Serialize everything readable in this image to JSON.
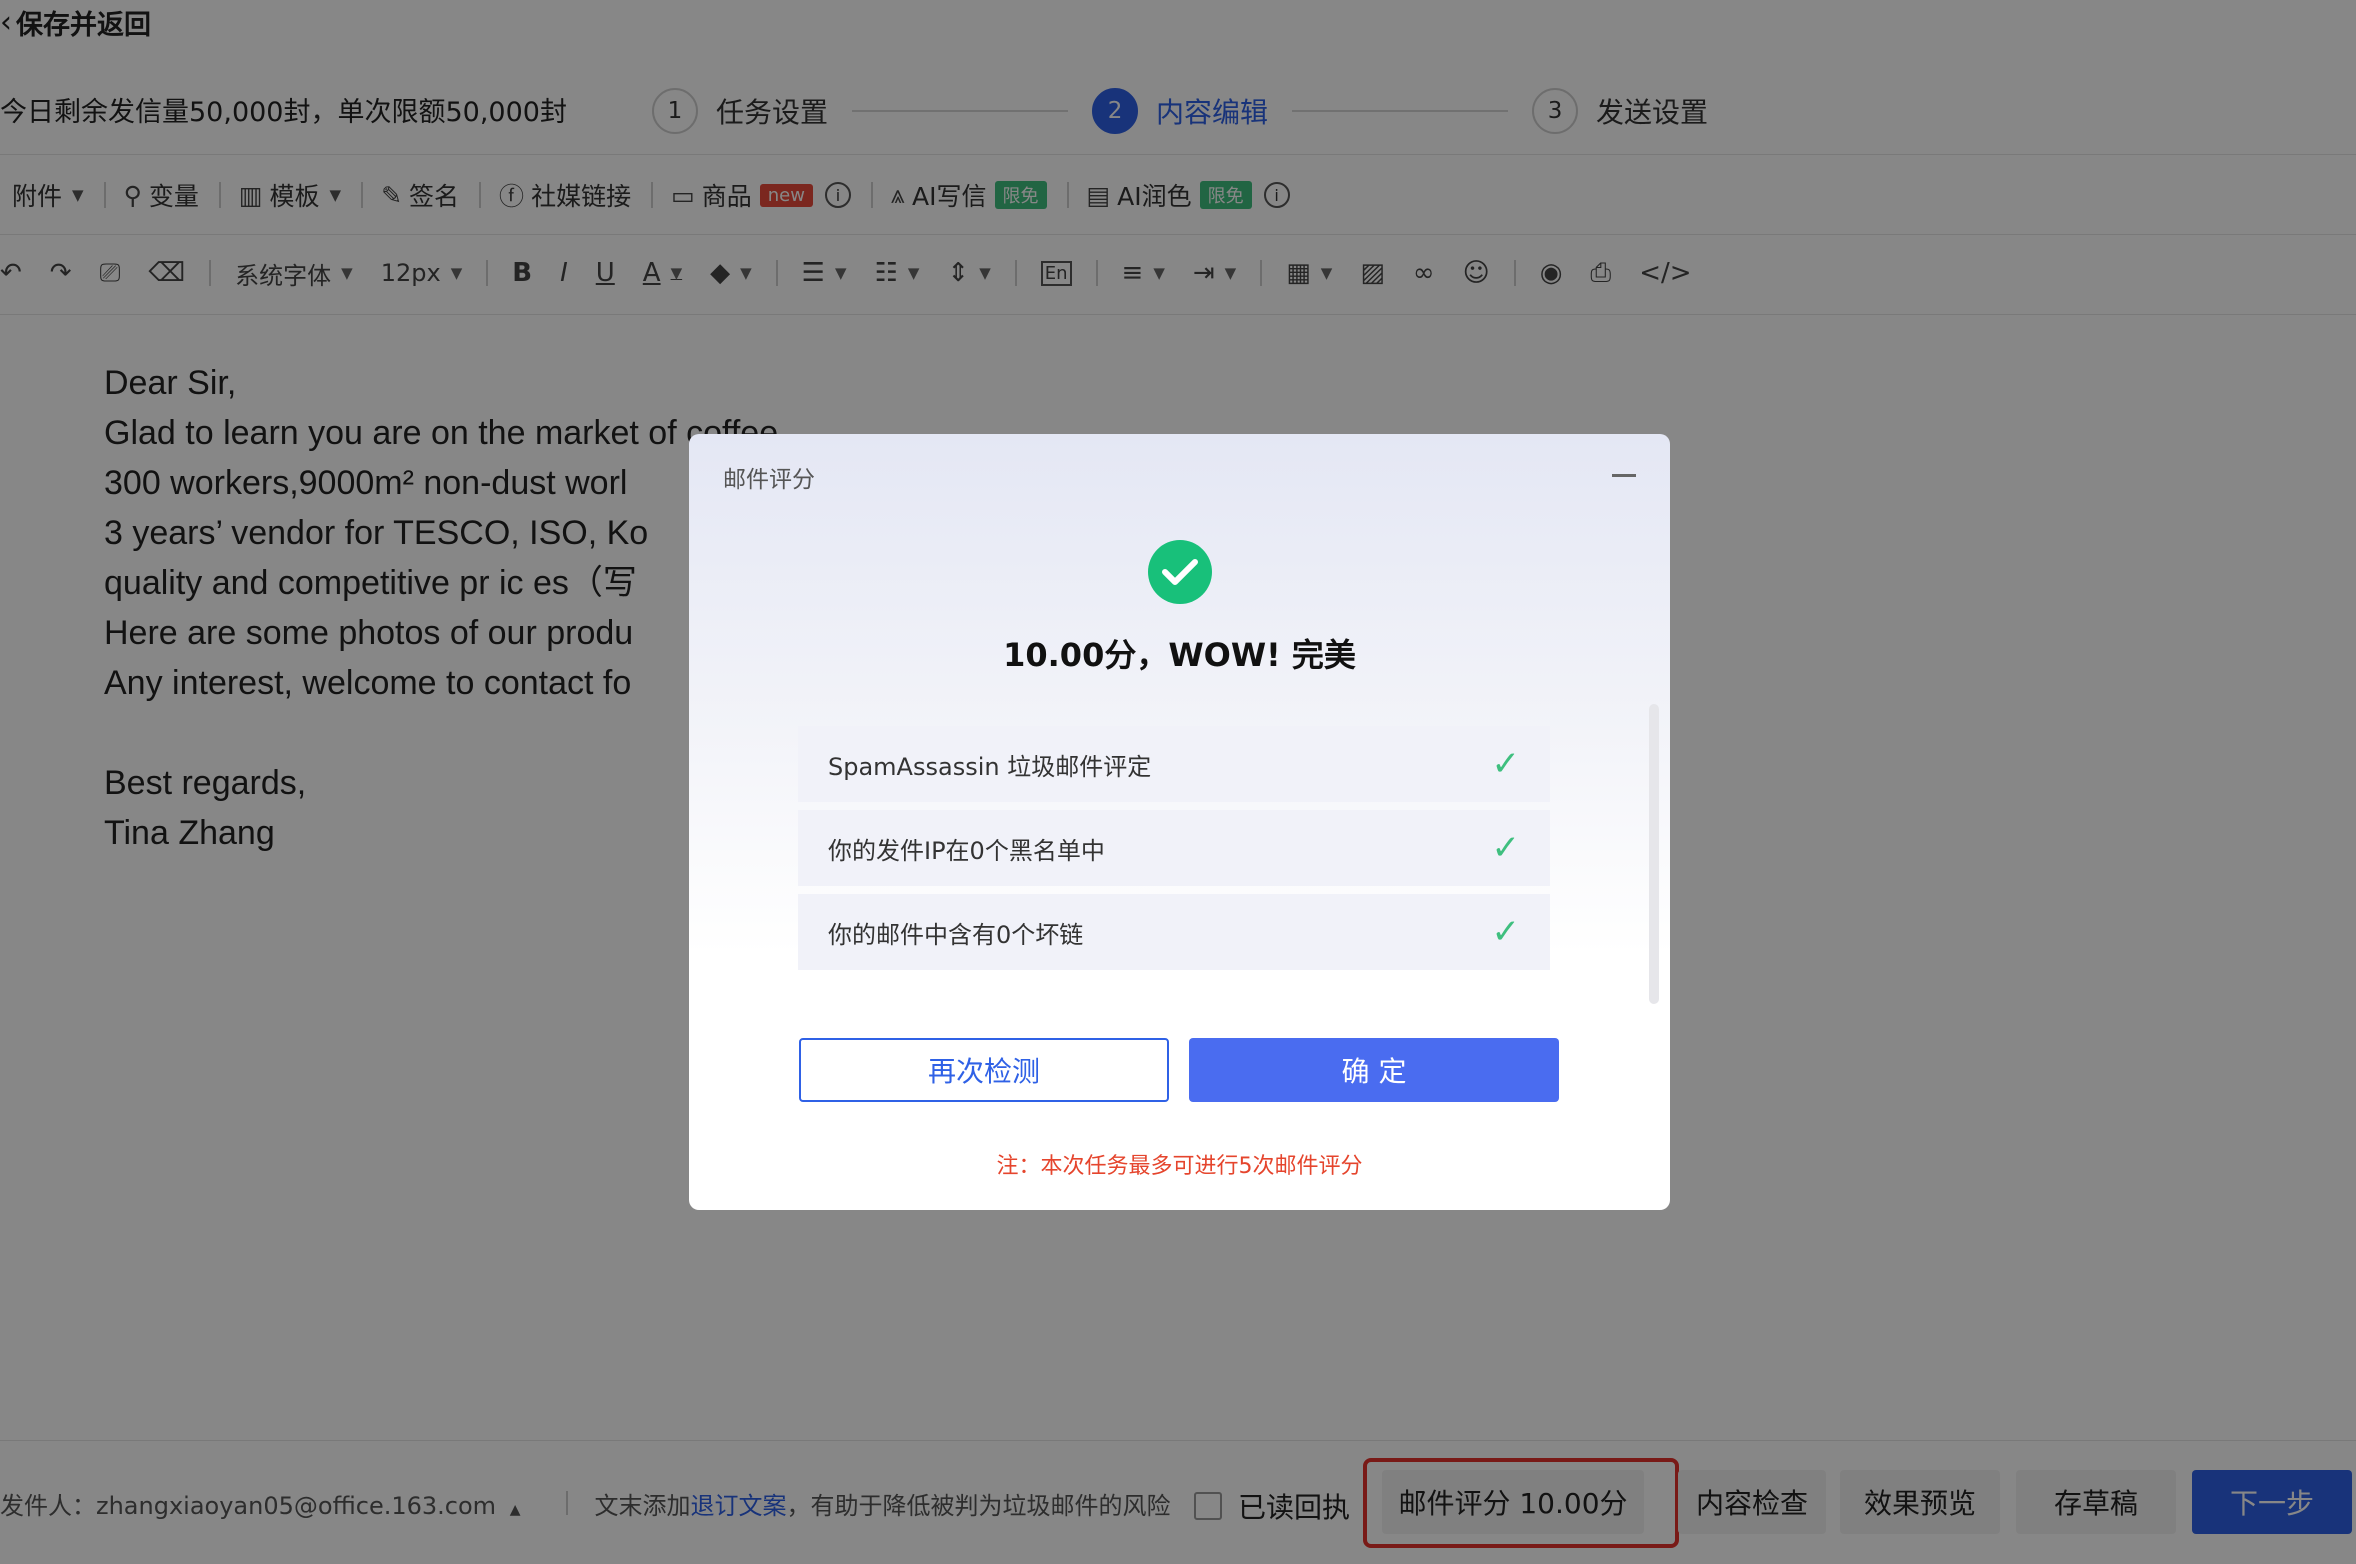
{
  "header": {
    "back_label": "保存并返回",
    "quota_text": "今日剩余发信量50,000封，单次限额50,000封"
  },
  "steps": [
    {
      "num": "1",
      "label": "任务设置"
    },
    {
      "num": "2",
      "label": "内容编辑"
    },
    {
      "num": "3",
      "label": "发送设置"
    }
  ],
  "toolbar1": {
    "attach": "附件",
    "variable": "变量",
    "template": "模板",
    "signature": "签名",
    "social": "社媒链接",
    "product": "商品",
    "new_badge": "new",
    "ai_write": "AI写信",
    "ai_polish": "AI润色",
    "free_badge": "限免"
  },
  "toolbar2": {
    "font_family": "系统字体",
    "font_size": "12px"
  },
  "editor": {
    "lines": [
      "Dear Sir,",
      "Glad to learn you are on the market of coffee",
      "300 workers,9000m² non-dust worl",
      "3 years’ vendor for TESCO, ISO, Ko",
      "quality and competitive pr ic es（写",
      "Here are some photos of our produ",
      "Any interest, welcome to contact fo",
      "",
      "Best regards,",
      "Tina Zhang"
    ]
  },
  "footer": {
    "sender_label": "发件人：zhangxiaoyan05@office.163.com",
    "tip_prefix": "文末添加",
    "tip_link": "退订文案",
    "tip_suffix": "，有助于降低被判为垃圾邮件的风险",
    "read_receipt": "已读回执",
    "score_button": "邮件评分 10.00分",
    "check_button": "内容检查",
    "preview_button": "效果预览",
    "draft_button": "存草稿",
    "next_button": "下一步"
  },
  "modal": {
    "title": "邮件评分",
    "score_text": "10.00分，WOW! 完美",
    "checks": [
      "SpamAssassin 垃圾邮件评定",
      "你的发件IP在0个黑名单中",
      "你的邮件中含有0个坏链"
    ],
    "retry_button": "再次检测",
    "confirm_button": "确 定",
    "note": "注：本次任务最多可进行5次邮件评分"
  },
  "colors": {
    "accent": "#2f61e6",
    "success": "#18c07a",
    "warning": "#e5452d",
    "highlight_box": "#e5322d"
  }
}
